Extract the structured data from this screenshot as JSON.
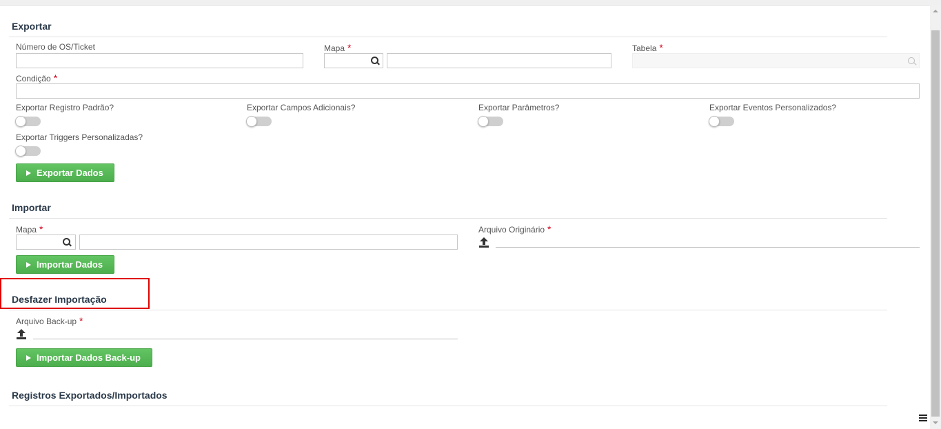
{
  "export": {
    "title": "Exportar",
    "os_label": "Número de OS/Ticket",
    "mapa_label": "Mapa",
    "tabela_label": "Tabela",
    "condicao_label": "Condição",
    "required_mark": "*",
    "toggles": [
      "Exportar Registro Padrão?",
      "Exportar Campos Adicionais?",
      "Exportar Parâmetros?",
      "Exportar Eventos Personalizados?",
      "Exportar Triggers Personalizadas?"
    ],
    "button": "Exportar Dados"
  },
  "import": {
    "title": "Importar",
    "mapa_label": "Mapa",
    "arquivo_label": "Arquivo Originário",
    "button": "Importar Dados"
  },
  "undo": {
    "title": "Desfazer Importação",
    "arquivo_label": "Arquivo Back-up",
    "button": "Importar Dados Back-up"
  },
  "records": {
    "title": "Registros Exportados/Importados"
  },
  "colors": {
    "accent_green": "#5cb85c",
    "required_red": "#d0021b",
    "highlight_red": "#e00000"
  }
}
